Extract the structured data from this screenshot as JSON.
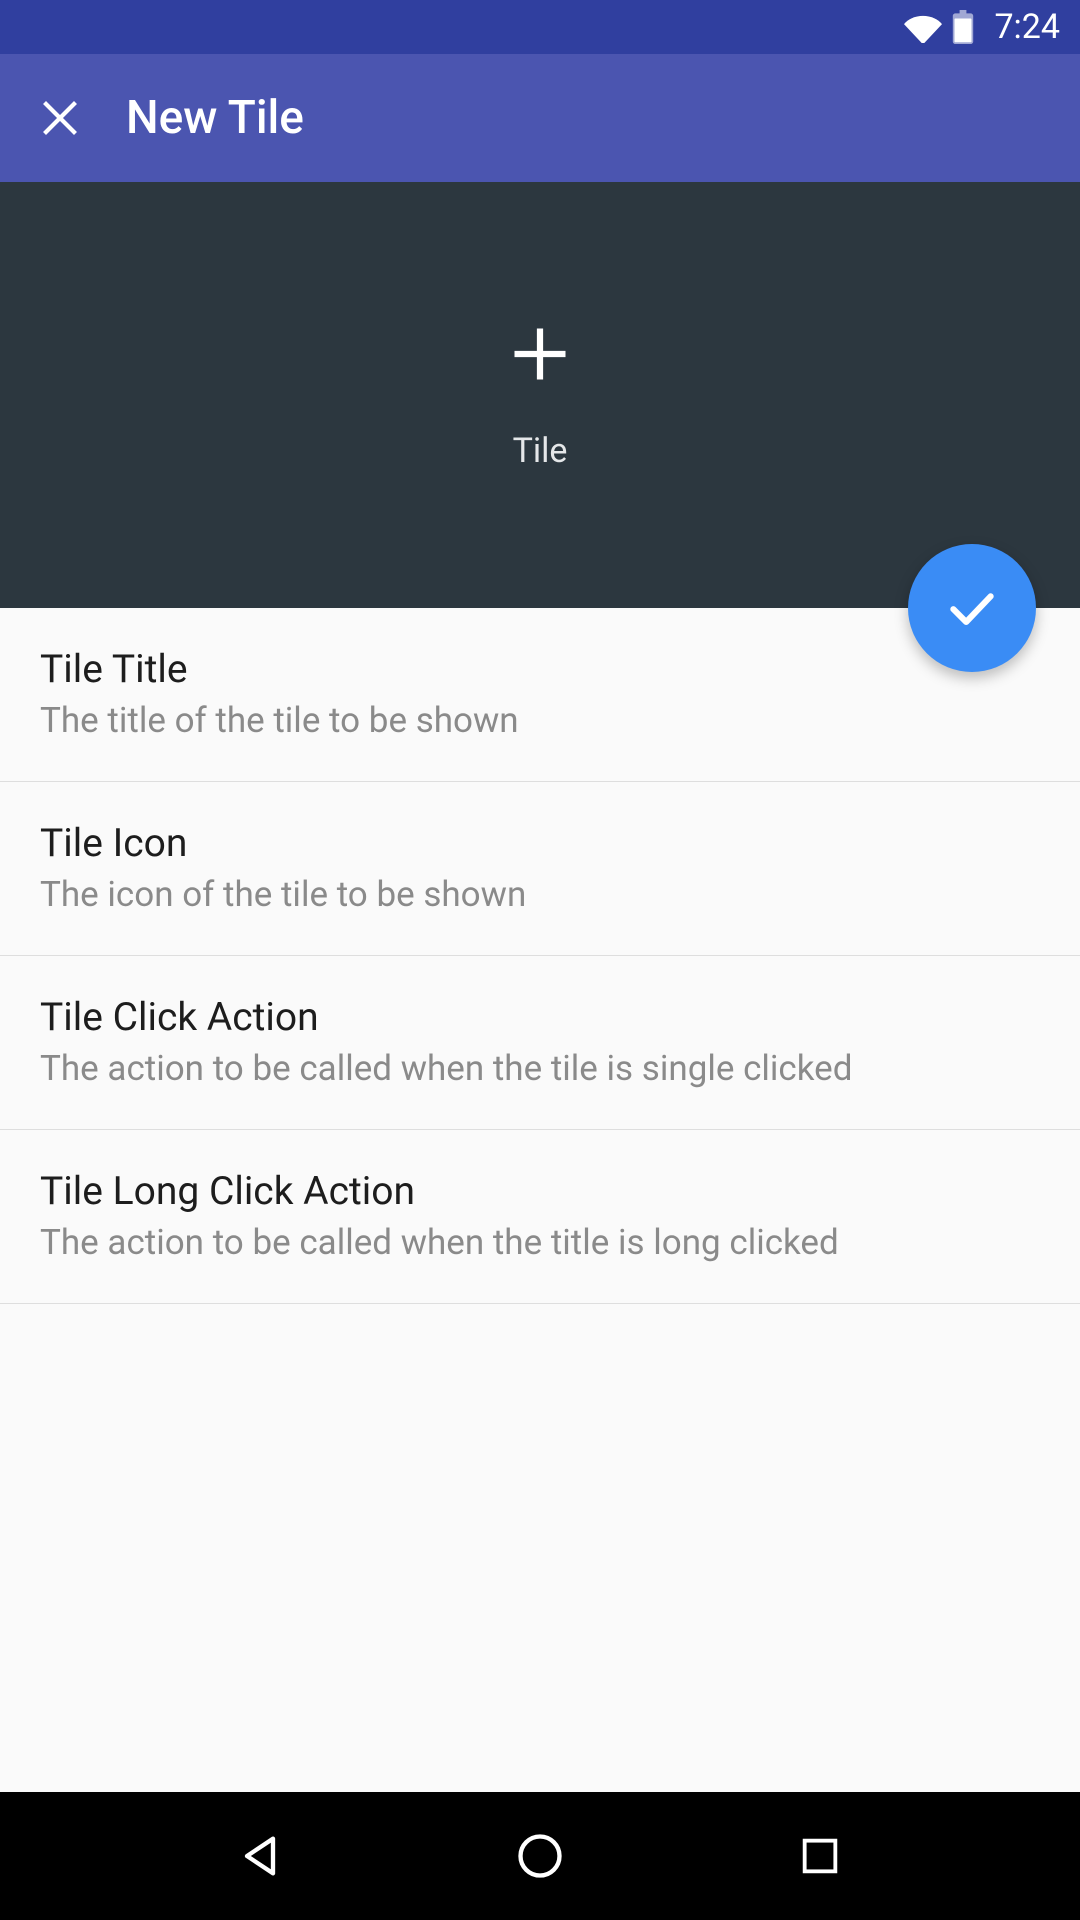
{
  "status": {
    "time": "7:24"
  },
  "header": {
    "title": "New Tile"
  },
  "preview": {
    "label": "Tile"
  },
  "settings": [
    {
      "title": "Tile Title",
      "subtitle": "The title of the tile to be shown"
    },
    {
      "title": "Tile Icon",
      "subtitle": "The icon of the tile to be shown"
    },
    {
      "title": "Tile Click Action",
      "subtitle": "The action to be called when the tile is single clicked"
    },
    {
      "title": "Tile Long Click Action",
      "subtitle": "The action to be called when the title is long clicked"
    }
  ]
}
